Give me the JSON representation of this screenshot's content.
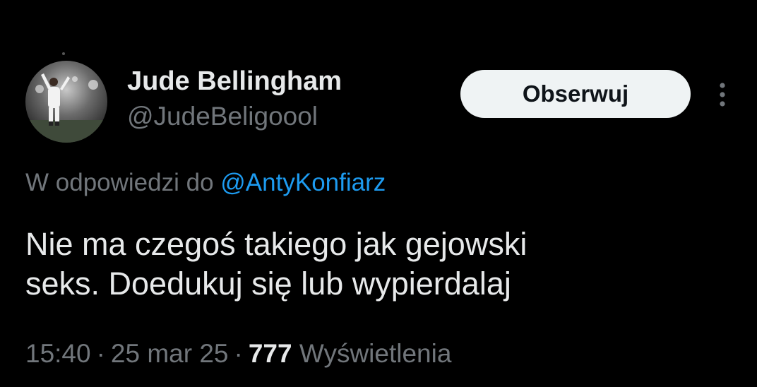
{
  "author": {
    "display_name": "Jude Bellingham",
    "handle": "@JudeBeligoool",
    "avatar_icon": "profile-photo-icon"
  },
  "actions": {
    "follow_label": "Obserwuj",
    "more_icon": "more-vertical-icon"
  },
  "reply": {
    "prefix": "W odpowiedzi do",
    "mention": "@AntyKonfiarz"
  },
  "tweet": {
    "line1": "Nie ma czegoś takiego jak gejowski",
    "line2": "seks. Doedukuj się lub wypierdalaj"
  },
  "meta": {
    "time": "15:40",
    "separator": "·",
    "date": "25 mar 25",
    "views_count": "777",
    "views_label": "Wyświetlenia"
  },
  "colors": {
    "background": "#000000",
    "primary_text": "#e7e9ea",
    "secondary_text": "#71767b",
    "link": "#1d9bf0",
    "follow_button_bg": "#eff3f4",
    "follow_button_text": "#0f1419"
  }
}
